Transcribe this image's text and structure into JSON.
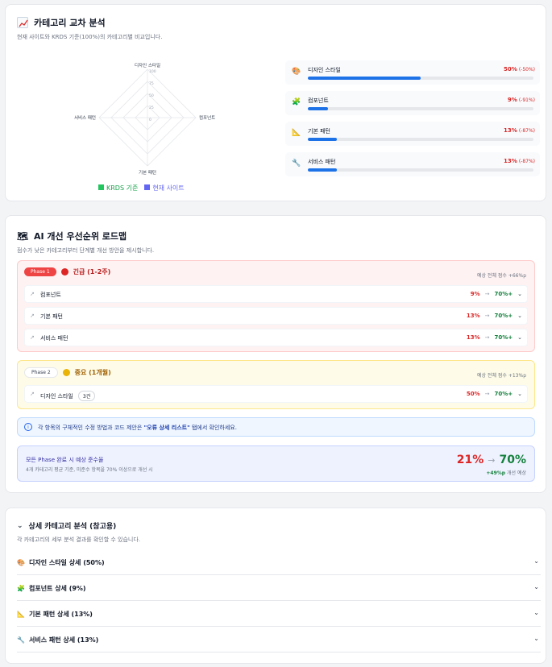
{
  "section1": {
    "title": "카테고리 교차 분석",
    "subtitle": "현재 사이트와 KRDS 기준(100%)의 카테고리별 비교입니다.",
    "radar": {
      "labels": [
        "디자인 스타일",
        "컴포넌트",
        "기본 패턴",
        "서비스 패턴"
      ],
      "ticks": [
        "100",
        "75",
        "50",
        "25",
        "0"
      ]
    },
    "legend": {
      "krds": "KRDS 기준",
      "current": "현재 사이트"
    },
    "colors": {
      "krds": "#22c55e",
      "current": "#6366f1",
      "bar": "#1d72e8"
    },
    "categories": [
      {
        "icon": "palette-icon",
        "glyph": "🎨",
        "name": "디자인 스타일",
        "value": "50%",
        "delta": "(-50%)",
        "pct": 50
      },
      {
        "icon": "puzzle-icon",
        "glyph": "🧩",
        "name": "컴포넌트",
        "value": "9%",
        "delta": "(-91%)",
        "pct": 9
      },
      {
        "icon": "ruler-icon",
        "glyph": "📐",
        "name": "기본 패턴",
        "value": "13%",
        "delta": "(-87%)",
        "pct": 13
      },
      {
        "icon": "wrench-icon",
        "glyph": "🔧",
        "name": "서비스 패턴",
        "value": "13%",
        "delta": "(-87%)",
        "pct": 13
      }
    ]
  },
  "section2": {
    "title": "AI 개선 우선순위 로드맵",
    "subtitle": "점수가 낮은 카테고리부터 단계별 개선 방안을 제시합니다.",
    "phase1": {
      "badge": "Phase 1",
      "label": "긴급 (1-2주)",
      "estimate": "예상 전체 점수 +66%p",
      "rows": [
        {
          "name": "컴포넌트",
          "from": "9%",
          "arrow": "→",
          "to": "70%+"
        },
        {
          "name": "기본 패턴",
          "from": "13%",
          "arrow": "→",
          "to": "70%+"
        },
        {
          "name": "서비스 패턴",
          "from": "13%",
          "arrow": "→",
          "to": "70%+"
        }
      ]
    },
    "phase2": {
      "badge": "Phase 2",
      "label": "중요 (1개월)",
      "estimate": "예상 전체 점수 +13%p",
      "rows": [
        {
          "name": "디자인 스타일",
          "count": "3건",
          "from": "50%",
          "arrow": "→",
          "to": "70%+"
        }
      ]
    },
    "info": {
      "before": "각 항목의 구체적인 수정 방법과 코드 제안은 ",
      "bold": "\"오류 상세 리스트\"",
      "after": " 탭에서 확인하세요."
    },
    "summary": {
      "title": "모든 Phase 완료 시 예상 준수율",
      "desc": "4개 카테고리 평균 기준, 미준수 항목을 70% 이상으로 개선 시",
      "from": "21%",
      "arrow": "→",
      "to": "70%",
      "gain": "+49%p",
      "gain_suffix": " 개선 예상"
    }
  },
  "section3": {
    "title": "상세 카테고리 분석 (참고용)",
    "subtitle": "각 카테고리의 세부 분석 결과를 확인할 수 있습니다.",
    "items": [
      {
        "icon": "palette-icon",
        "glyph": "🎨",
        "label": "디자인 스타일 상세 (50%)"
      },
      {
        "icon": "puzzle-icon",
        "glyph": "🧩",
        "label": "컴포넌트 상세 (9%)"
      },
      {
        "icon": "ruler-icon",
        "glyph": "📐",
        "label": "기본 패턴 상세 (13%)"
      },
      {
        "icon": "wrench-icon",
        "glyph": "🔧",
        "label": "서비스 패턴 상세 (13%)"
      }
    ]
  }
}
